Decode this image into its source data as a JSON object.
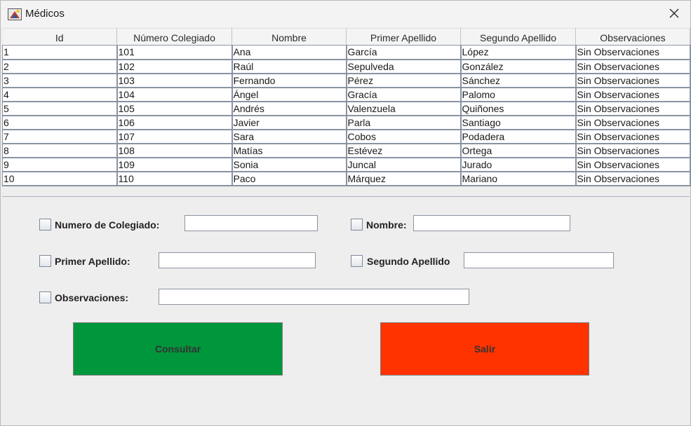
{
  "window": {
    "title": "Médicos",
    "icon": "java-app-icon",
    "close_icon": "close-icon"
  },
  "table": {
    "columns": [
      "Id",
      "Número Colegiado",
      "Nombre",
      "Primer Apellido",
      "Segundo Apellido",
      "Observaciones"
    ],
    "rows": [
      [
        "1",
        "101",
        "Ana",
        "García",
        "López",
        "Sin Observaciones"
      ],
      [
        "2",
        "102",
        "Raúl",
        "Sepulveda",
        "González",
        "Sin Observaciones"
      ],
      [
        "3",
        "103",
        "Fernando",
        "Pérez",
        "Sánchez",
        "Sin Observaciones"
      ],
      [
        "4",
        "104",
        "Ángel",
        "Gracía",
        "Palomo",
        "Sin Observaciones"
      ],
      [
        "5",
        "105",
        "Andrés",
        "Valenzuela",
        "Quiñones",
        "Sin Observaciones"
      ],
      [
        "6",
        "106",
        "Javier",
        "Parla",
        "Santiago",
        "Sin Observaciones"
      ],
      [
        "7",
        "107",
        "Sara",
        "Cobos",
        "Podadera",
        "Sin Observaciones"
      ],
      [
        "8",
        "108",
        "Matías",
        "Estévez",
        "Ortega",
        "Sin Observaciones"
      ],
      [
        "9",
        "109",
        "Sonia",
        "Juncal",
        "Jurado",
        "Sin Observaciones"
      ],
      [
        "10",
        "110",
        "Paco",
        "Márquez",
        "Mariano",
        "Sin Observaciones"
      ]
    ]
  },
  "form": {
    "numero_colegiado": {
      "label": "Numero de Colegiado:",
      "value": "",
      "checked": false
    },
    "nombre": {
      "label": "Nombre:",
      "value": "",
      "checked": false
    },
    "primer_apellido": {
      "label": "Primer Apellido:",
      "value": "",
      "checked": false
    },
    "segundo_apellido": {
      "label": "Segundo Apellido",
      "value": "",
      "checked": false
    },
    "observaciones": {
      "label": "Observaciones:",
      "value": "",
      "checked": false
    }
  },
  "buttons": {
    "consultar": {
      "label": "Consultar",
      "color": "#00963c"
    },
    "salir": {
      "label": "Salir",
      "color": "#ff3300"
    }
  }
}
